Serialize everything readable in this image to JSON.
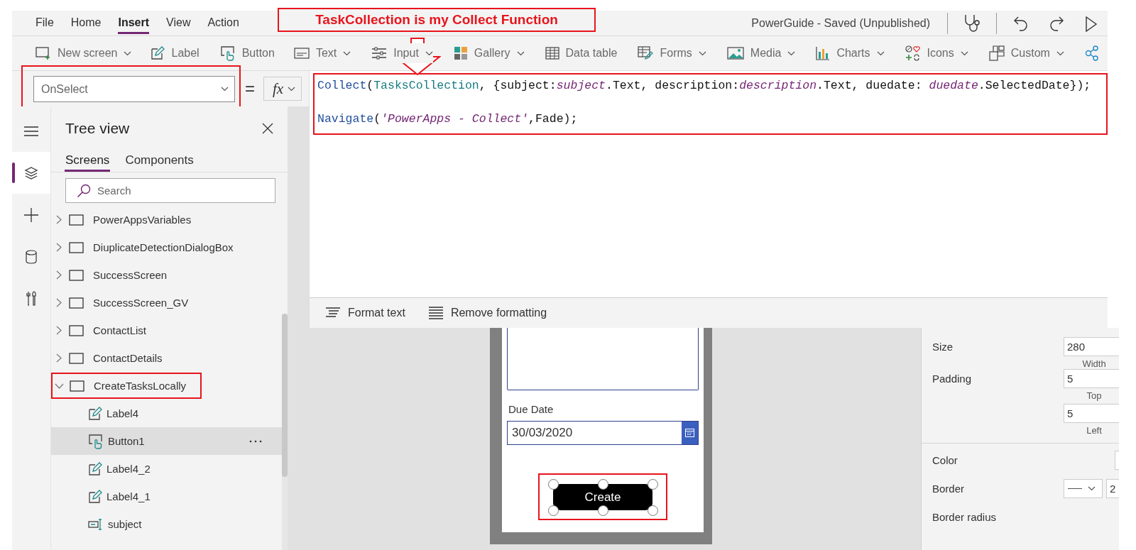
{
  "annotation": {
    "text": "TaskCollection is my Collect Function"
  },
  "menu": [
    {
      "label": "File",
      "selected": false
    },
    {
      "label": "Home",
      "selected": false
    },
    {
      "label": "Insert",
      "selected": true
    },
    {
      "label": "View",
      "selected": false
    },
    {
      "label": "Action",
      "selected": false
    }
  ],
  "document_title": "PowerGuide - Saved (Unpublished)",
  "toolbar": [
    {
      "kind": "screen",
      "label": "New screen",
      "dropdown": true
    },
    {
      "kind": "label",
      "label": "Label",
      "dropdown": false
    },
    {
      "kind": "button",
      "label": "Button",
      "dropdown": false
    },
    {
      "kind": "text",
      "label": "Text",
      "dropdown": true
    },
    {
      "kind": "input",
      "label": "Input",
      "dropdown": true
    },
    {
      "kind": "gallery",
      "label": "Gallery",
      "dropdown": true
    },
    {
      "kind": "table",
      "label": "Data table",
      "dropdown": false
    },
    {
      "kind": "forms",
      "label": "Forms",
      "dropdown": true
    },
    {
      "kind": "media",
      "label": "Media",
      "dropdown": true
    },
    {
      "kind": "charts",
      "label": "Charts",
      "dropdown": true
    },
    {
      "kind": "icons",
      "label": "Icons",
      "dropdown": true
    },
    {
      "kind": "custom",
      "label": "Custom",
      "dropdown": true
    },
    {
      "kind": "nodes",
      "dropdown": false
    }
  ],
  "formula_bar": {
    "property": "OnSelect",
    "property_highlighted": true,
    "equals": "=",
    "function_label": "fx",
    "code_highlighted": true,
    "code_lines": [
      [
        {
          "kind": "function",
          "text": "Collect"
        },
        {
          "kind": "plain",
          "text": "("
        },
        {
          "kind": "collection",
          "text": "TasksCollection"
        },
        {
          "kind": "plain",
          "text": ", {subject:"
        },
        {
          "kind": "control",
          "text": "subject"
        },
        {
          "kind": "plain",
          "text": ".Text, description:"
        },
        {
          "kind": "control",
          "text": "description"
        },
        {
          "kind": "plain",
          "text": ".Text, duedate: "
        },
        {
          "kind": "control",
          "text": "duedate"
        },
        {
          "kind": "plain",
          "text": ".SelectedDate});"
        }
      ],
      [
        {
          "kind": "function",
          "text": "Navigate"
        },
        {
          "kind": "plain",
          "text": "("
        },
        {
          "kind": "string",
          "text": "'PowerApps - Collect'"
        },
        {
          "kind": "plain",
          "text": ",Fade);"
        }
      ]
    ],
    "format_bar": [
      {
        "kind": "format",
        "label": "Format text"
      },
      {
        "kind": "remove",
        "label": "Remove formatting"
      }
    ]
  },
  "rail": [
    {
      "kind": "menu",
      "selected": false
    },
    {
      "kind": "layers",
      "selected": true
    },
    {
      "kind": "plus",
      "selected": false
    },
    {
      "kind": "data",
      "selected": false
    },
    {
      "kind": "tools",
      "selected": false
    }
  ],
  "tree_view": {
    "title": "Tree view",
    "tabs": [
      {
        "label": "Screens",
        "selected": true
      },
      {
        "label": "Components",
        "selected": false
      }
    ],
    "search": {
      "placeholder": "Search"
    },
    "items": [
      {
        "kind": "screen",
        "label": "PowerAppsVariables",
        "expanded": false,
        "selected": false,
        "highlighted": false
      },
      {
        "kind": "screen",
        "label": "DiuplicateDetectionDialogBox",
        "expanded": false,
        "selected": false,
        "highlighted": false
      },
      {
        "kind": "screen",
        "label": "SuccessScreen",
        "expanded": false,
        "selected": false,
        "highlighted": false
      },
      {
        "kind": "screen",
        "label": "SuccessScreen_GV",
        "expanded": false,
        "selected": false,
        "highlighted": false
      },
      {
        "kind": "screen",
        "label": "ContactList",
        "expanded": false,
        "selected": false,
        "highlighted": false
      },
      {
        "kind": "screen",
        "label": "ContactDetails",
        "expanded": false,
        "selected": false,
        "highlighted": false
      },
      {
        "kind": "screen",
        "label": "CreateTasksLocally",
        "expanded": true,
        "selected": false,
        "highlighted": true,
        "children": [
          {
            "kind": "label",
            "label": "Label4",
            "selected": false
          },
          {
            "kind": "button",
            "label": "Button1",
            "selected": true
          },
          {
            "kind": "label",
            "label": "Label4_2",
            "selected": false
          },
          {
            "kind": "label",
            "label": "Label4_1",
            "selected": false
          },
          {
            "kind": "textinput",
            "label": "subject",
            "selected": false
          }
        ]
      }
    ]
  },
  "canvas": {
    "date_label": "Due Date",
    "date_value": "30/03/2020",
    "button": {
      "label": "Create",
      "selected": true,
      "highlighted": true
    }
  },
  "properties": [
    {
      "kind": "fields",
      "label": "Size",
      "fields": [
        {
          "value": "280",
          "caption": "Width"
        }
      ]
    },
    {
      "kind": "fields",
      "label": "Padding",
      "fields": [
        {
          "value": "5",
          "caption": "Top"
        },
        {
          "value": "5",
          "caption": "Left"
        }
      ]
    },
    {
      "kind": "color",
      "label": "Color"
    },
    {
      "kind": "border",
      "label": "Border",
      "value": "2"
    },
    {
      "kind": "plain",
      "label": "Border radius"
    }
  ]
}
